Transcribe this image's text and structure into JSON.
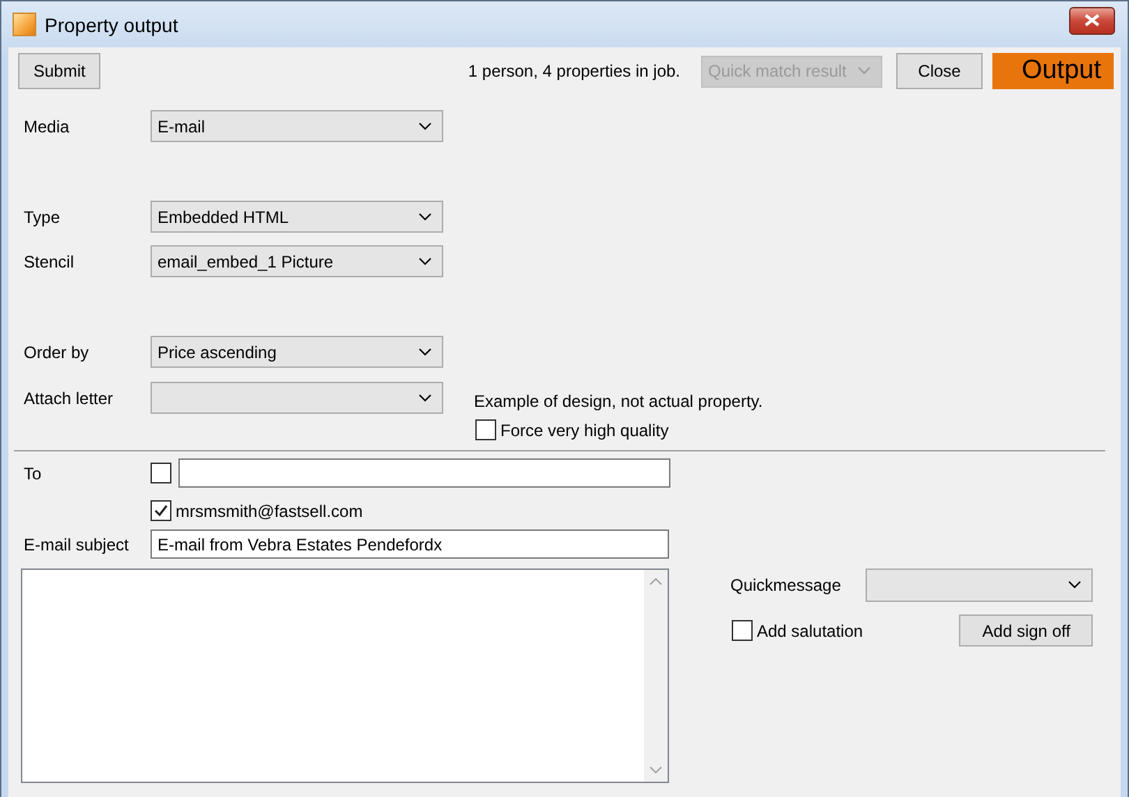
{
  "window": {
    "title": "Property output"
  },
  "toolbar": {
    "submit": "Submit",
    "job_summary": "1 person, 4 properties in job.",
    "quick_match": {
      "value": "Quick match result",
      "disabled": true
    },
    "close": "Close",
    "output": "Output"
  },
  "field_groups": [
    [
      {
        "label": "Media",
        "value": "E-mail"
      }
    ],
    [
      {
        "label": "Type",
        "value": "Embedded HTML"
      },
      {
        "label": "Stencil",
        "value": "email_embed_1 Picture"
      }
    ],
    [
      {
        "label": "Order by",
        "value": "Price ascending"
      },
      {
        "label": "Attach letter"
      }
    ]
  ],
  "design_note": "Example of design, not actual property.",
  "force_quality": {
    "label": "Force very high quality",
    "checked": false
  },
  "to": {
    "label": "To",
    "checked": false
  },
  "recipients": [
    {
      "email": "mrsmsmith@fastsell.com",
      "checked": true
    }
  ],
  "subject": {
    "label": "E-mail subject",
    "value": "E-mail from Vebra Estates Pendefordx"
  },
  "quickmessage": {
    "label": "Quickmessage"
  },
  "add_salutation": {
    "label": "Add salutation",
    "checked": false
  },
  "add_sign_off": "Add sign off"
}
